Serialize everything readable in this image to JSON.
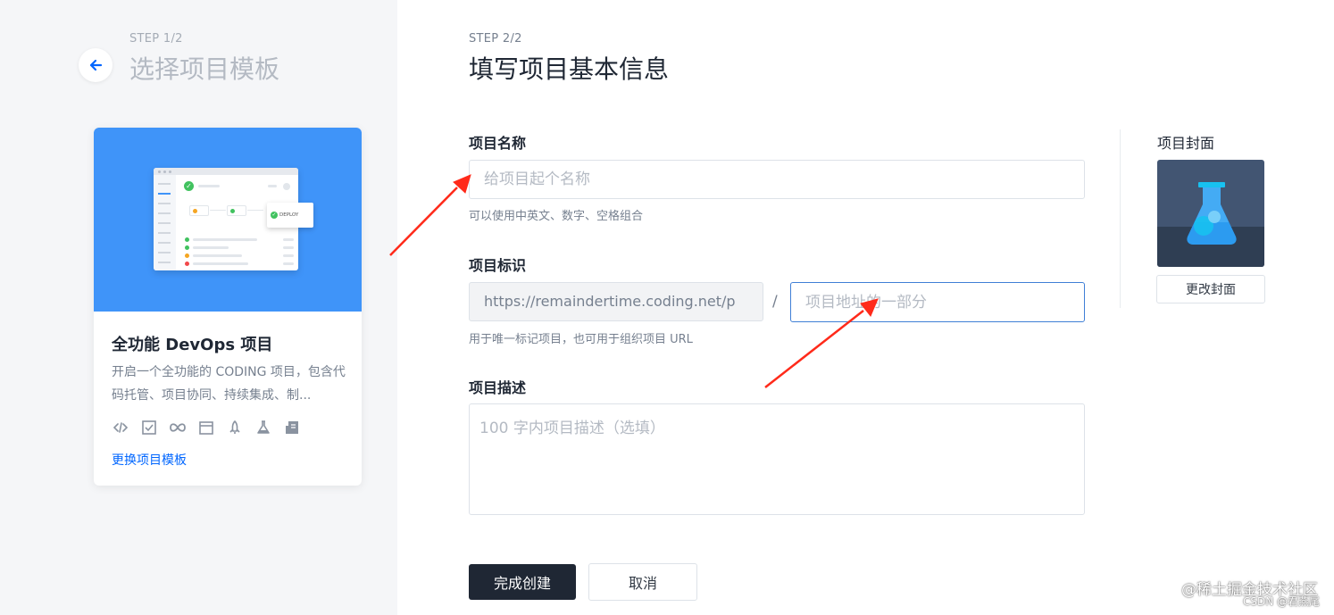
{
  "step1": {
    "label": "STEP 1/2",
    "title": "选择项目模板",
    "back_icon": "arrow-left-icon"
  },
  "template": {
    "mock_deploy_label": "DEPLOY",
    "title": "全功能 DevOps 项目",
    "description": "开启一个全功能的 CODING 项目，包含代码托管、项目协同、持续集成、制...",
    "feature_icons": [
      "code-icon",
      "task-board-icon",
      "infinity-icon",
      "window-icon",
      "rocket-icon",
      "flask-icon",
      "document-icon"
    ],
    "change_link": "更换项目模板",
    "banner_color": "#3f94f9"
  },
  "step2": {
    "label": "STEP 2/2",
    "title": "填写项目基本信息"
  },
  "form": {
    "name": {
      "label": "项目名称",
      "placeholder": "给项目起个名称",
      "hint": "可以使用中英文、数字、空格组合"
    },
    "identifier": {
      "label": "项目标识",
      "url_prefix": "https://remaindertime.coding.net/p",
      "separator": "/",
      "placeholder": "项目地址的一部分",
      "hint": "用于唯一标记项目，也可用于组织项目 URL"
    },
    "description": {
      "label": "项目描述",
      "placeholder": "100 字内项目描述（选填）"
    },
    "submit_label": "完成创建",
    "cancel_label": "取消"
  },
  "cover": {
    "label": "项目封面",
    "change_label": "更改封面",
    "icon": "flask-icon"
  },
  "watermark": {
    "main": "@稀土掘金技术社区",
    "sub": "CSDN @君燕尾"
  },
  "colors": {
    "primary_dark": "#1f2734",
    "link_blue": "#0066ff",
    "annotation_red": "#ff2a1a"
  }
}
